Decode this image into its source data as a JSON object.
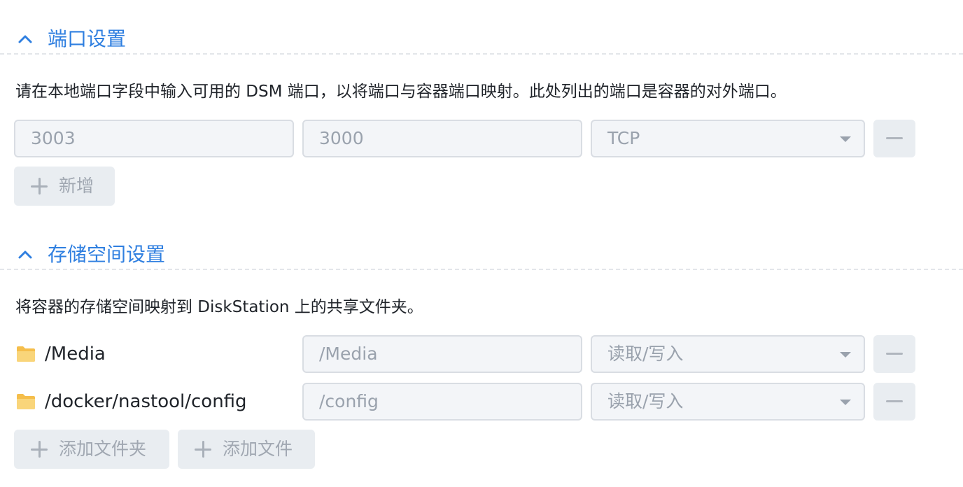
{
  "port_section": {
    "title": "端口设置",
    "description": "请在本地端口字段中输入可用的 DSM 端口，以将端口与容器端口映射。此处列出的端口是容器的对外端口。",
    "rows": [
      {
        "local_port": "3003",
        "container_port": "3000",
        "protocol": "TCP"
      }
    ],
    "add_label": "新增"
  },
  "storage_section": {
    "title": "存储空间设置",
    "description": "将容器的存储空间映射到 DiskStation 上的共享文件夹。",
    "rows": [
      {
        "folder": "/Media",
        "mount_path": "/Media",
        "permission": "读取/写入"
      },
      {
        "folder": "/docker/nastool/config",
        "mount_path": "/config",
        "permission": "读取/写入"
      }
    ],
    "add_folder_label": "添加文件夹",
    "add_file_label": "添加文件"
  },
  "colors": {
    "accent": "#2f7fe0",
    "folder": "#f7c95c",
    "field_bg": "#f3f5f8",
    "button_bg": "#e9edf1"
  },
  "icons": {
    "section_toggle": "chevron-up-icon",
    "remove": "minus-icon",
    "add": "plus-icon",
    "folder": "folder-icon",
    "dropdown": "caret-down-icon"
  }
}
